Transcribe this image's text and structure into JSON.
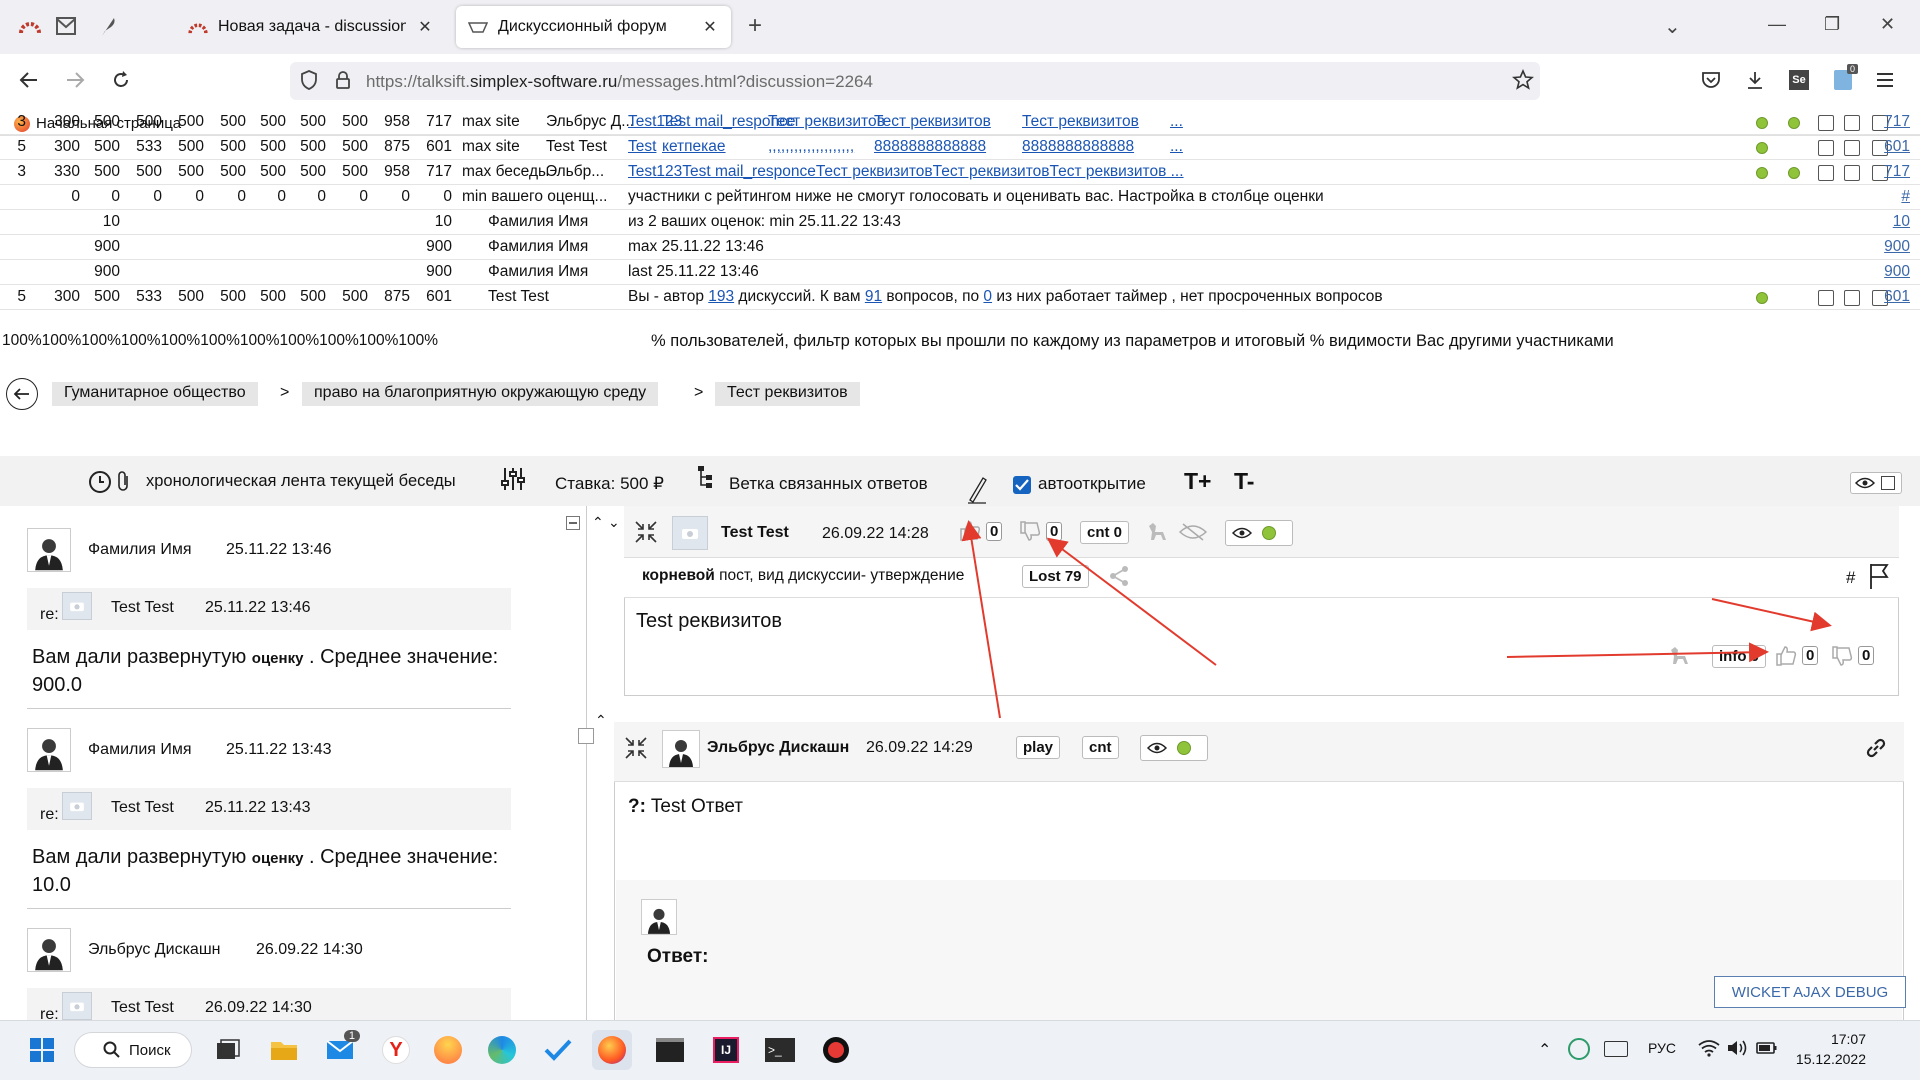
{
  "browser": {
    "tabs": [
      {
        "label": "Новая задача - discussion - Re",
        "close": "✕"
      },
      {
        "label": "Дискуссионный форум",
        "close": "✕"
      }
    ],
    "new_tab": "+",
    "url_prefix": "https://talksift.",
    "url_domain": "simplex-software.ru",
    "url_path": "/messages.html?discussion=2264",
    "bookmark": "Начальная страница",
    "window_controls": [
      "⌄",
      "—",
      "❐",
      "✕"
    ]
  },
  "stats": {
    "rows": [
      {
        "cols": [
          "3",
          "300",
          "500",
          "500",
          "500",
          "500",
          "500",
          "500",
          "500",
          "958",
          "717"
        ],
        "label": "max site",
        "name": "Эльбрус Д...",
        "links": [
          "Test123",
          "Test mail_responce",
          "Тест реквизитов",
          "Тест реквизитов",
          "Тест реквизитов",
          "..."
        ],
        "link_right": "717",
        "dots": 2
      },
      {
        "cols": [
          "5",
          "300",
          "500",
          "533",
          "500",
          "500",
          "500",
          "500",
          "500",
          "875",
          "601"
        ],
        "label": "max site",
        "name": "Test Test",
        "links": [
          "Test",
          "кетпекае",
          ",,,,,,,,,,,,,,,,,,,,",
          "8888888888888",
          "8888888888888",
          "..."
        ],
        "link_right": "601",
        "dots": 1
      },
      {
        "cols": [
          "3",
          "330",
          "500",
          "500",
          "500",
          "500",
          "500",
          "500",
          "500",
          "958",
          "717"
        ],
        "label": "max беседы",
        "name": "Эльбр...",
        "links": [
          "Test123Test mail_responceТест реквизитовТест реквизитовТест реквизитов ..."
        ],
        "link_right": "717",
        "dots": 2
      },
      {
        "cols": [
          "",
          "0",
          "0",
          "0",
          "0",
          "0",
          "0",
          "0",
          "0",
          "0",
          "0"
        ],
        "label": "min вашего оценщ...",
        "name": "",
        "text": "участники с рейтингом ниже не смогут голосовать и оценивать вас. Настройка в столбце оценки",
        "link_right": "#"
      },
      {
        "cols": [
          "",
          "",
          "10",
          "",
          "",
          "",
          "",
          "",
          "",
          "",
          "10"
        ],
        "label": "",
        "name": "Фамилия Имя",
        "text": "из 2 ваших оценок: min 25.11.22 13:43",
        "link_right": "10"
      },
      {
        "cols": [
          "",
          "",
          "900",
          "",
          "",
          "",
          "",
          "",
          "",
          "",
          "900"
        ],
        "label": "",
        "name": "Фамилия Имя",
        "text": "max 25.11.22 13:46",
        "link_right": "900"
      },
      {
        "cols": [
          "",
          "",
          "900",
          "",
          "",
          "",
          "",
          "",
          "",
          "",
          "900"
        ],
        "label": "",
        "name": "Фамилия Имя",
        "text": "last 25.11.22 13:46",
        "link_right": "900"
      },
      {
        "cols": [
          "5",
          "300",
          "500",
          "533",
          "500",
          "500",
          "500",
          "500",
          "500",
          "875",
          "601"
        ],
        "label": "",
        "name": "Test Test",
        "author": {
          "pre": "Вы - автор ",
          "n1": "193",
          "mid1": " дискуссий. К вам ",
          "n2": "91",
          "mid2": " вопросов, по ",
          "n3": "0",
          "post": " из них работает таймер , нет просроченных вопросов"
        },
        "link_right": "601",
        "dots": 1
      }
    ],
    "percent_row": "100%100%100%100%100%100%100%100%100%100%100%",
    "percent_text": "% пользователей, фильтр которых вы прошли по каждому из параметров и итоговый % видимости Вас другими участниками"
  },
  "breadcrumb": [
    "Гуманитарное общество",
    "право на благоприятную окружающую среду",
    "Тест реквизитов"
  ],
  "breadcrumb_sep": ">",
  "toolbar": {
    "chrono": "хронологическая лента текущей беседы",
    "stake": "Ставка: 500 ₽",
    "branch": "Ветка связанных ответов",
    "autoopen": "автооткрытие",
    "t_plus": "T+",
    "t_minus": "T-"
  },
  "left_feed": [
    {
      "author": "Фамилия Имя",
      "time": "25.11.22 13:46",
      "re": "re:",
      "re_author": "Test Test",
      "re_time": "25.11.22 13:46",
      "text_pre": "Вам дали развернутую ",
      "text_small": "оценку",
      "text_post": " . Среднее значение: 900.0"
    },
    {
      "author": "Фамилия Имя",
      "time": "25.11.22 13:43",
      "re": "re:",
      "re_author": "Test Test",
      "re_time": "25.11.22 13:43",
      "text_pre": "Вам дали развернутую ",
      "text_small": "оценку",
      "text_post": " . Среднее значение: 10.0"
    },
    {
      "author": "Эльбрус Дискашн",
      "time": "26.09.22 14:30",
      "re": "re:",
      "re_author": "Test Test",
      "re_time": "26.09.22 14:30"
    }
  ],
  "root_post": {
    "author": "Test Test",
    "time": "26.09.22 14:28",
    "likes": "0",
    "dislikes": "0",
    "cnt": "cnt 0",
    "meta_bold": "корневой",
    "meta": " пост, вид дискуссии- утверждение",
    "lost": "Lost 79",
    "hash": "#",
    "body": "Test реквизитов",
    "info": "info 0",
    "info_likes": "0",
    "info_dislikes": "0"
  },
  "reply_post": {
    "author": "Эльбрус Дискашн",
    "time": "26.09.22 14:29",
    "play": "play",
    "cnt": "cnt",
    "body_prefix": "?:",
    "body": " Test Ответ",
    "answer_label": "Ответ:"
  },
  "debug_button": "WICKET AJAX DEBUG",
  "taskbar": {
    "search": "Поиск",
    "mail_badge": "1",
    "lang": "РУС",
    "time": "17:07",
    "date": "15.12.2022"
  },
  "colors": {
    "link": "#1a55b4",
    "green_dot": "#8fc43a",
    "arrow": "#e23b2e"
  }
}
